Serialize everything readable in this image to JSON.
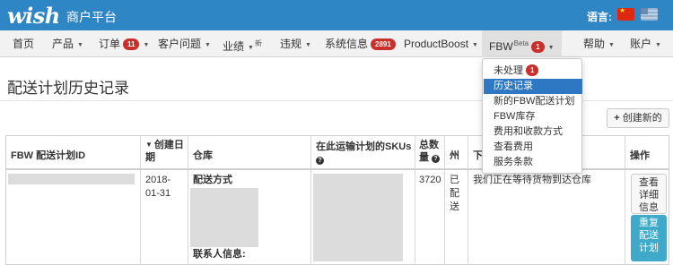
{
  "header": {
    "logo": "wish",
    "platform": "商户平台",
    "language_label": "语言:",
    "flags": [
      "cn-flag",
      "us-flag"
    ]
  },
  "nav": {
    "home": "首页",
    "products": "产品",
    "orders": "订单",
    "orders_badge": "11",
    "customer_issues": "客户问题",
    "performance": "业绩",
    "performance_sup": "新",
    "violations": "违规",
    "system_info": "系统信息",
    "system_info_badge": "2891",
    "productboost": "ProductBoost",
    "fbw": "FBW",
    "fbw_sup": "Beta",
    "fbw_badge": "1",
    "help": "帮助",
    "account": "账户"
  },
  "dropdown": {
    "items": [
      {
        "label": "未处理",
        "badge": "1"
      },
      {
        "label": "历史记录",
        "active": true
      },
      {
        "label": "新的FBW配送计划"
      },
      {
        "label": "FBW库存"
      },
      {
        "label": "费用和收款方式"
      },
      {
        "label": "查看费用"
      },
      {
        "label": "服务条款"
      }
    ]
  },
  "page": {
    "title": "配送计划历史记录",
    "create_button": "创建新的"
  },
  "table": {
    "headers": {
      "plan_id": "FBW 配送计划ID",
      "created_date_line1": "创建日",
      "created_date_line2": "期",
      "warehouse": "仓库",
      "skus": "在此运输计划的SKUs",
      "total_line1": "总数",
      "total_line2": "量",
      "state": "州",
      "note_partial": "下",
      "actions": "操作"
    },
    "row": {
      "date_line1": "2018-",
      "date_line2": "01-31",
      "shipping_method": "配送方式",
      "contact_info": "联系人信息:",
      "total": "3720",
      "state_line1": "已",
      "state_line2": "配",
      "state_line3": "送",
      "status_message": "我们正在等待货物到达仓库",
      "view_details_line1": "查看",
      "view_details_line2": "详细",
      "view_details_line3": "信息",
      "repeat_line1": "重复",
      "repeat_line2": "配送",
      "repeat_line3": "计划"
    }
  },
  "colors": {
    "header_bg": "#2f86c5",
    "active_menu": "#2d77c3",
    "badge": "#c9302c",
    "primary_button": "#3ea9c8"
  }
}
